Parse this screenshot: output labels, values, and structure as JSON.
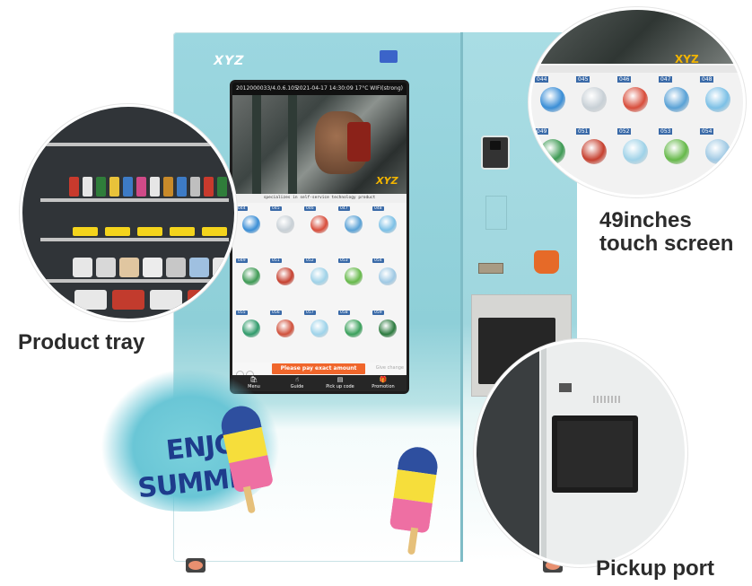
{
  "machine": {
    "brand_logo": "XYZ",
    "screen": {
      "status_left": "2012000033/4.0.6.105",
      "status_right": "2021-04-17 14:30:09  17°C  WIFI(strong)",
      "video_logo": "XYZ",
      "banner_text": "specializes in self-service technology product",
      "products": [
        {
          "slot": "044",
          "color": "#3a8ed6"
        },
        {
          "slot": "045",
          "color": "#c8d0d6"
        },
        {
          "slot": "046",
          "color": "#d84d3b"
        },
        {
          "slot": "047",
          "color": "#5aa2d6"
        },
        {
          "slot": "048",
          "color": "#7cc0e6"
        },
        {
          "slot": "049",
          "color": "#3e9a54"
        },
        {
          "slot": "051",
          "color": "#c6402f"
        },
        {
          "slot": "052",
          "color": "#9fd2e8"
        },
        {
          "slot": "053",
          "color": "#66b94a"
        },
        {
          "slot": "054",
          "color": "#9fc9e4"
        },
        {
          "slot": "055",
          "color": "#2f9a6a"
        },
        {
          "slot": "056",
          "color": "#d0503b"
        },
        {
          "slot": "057",
          "color": "#9ed3ea"
        },
        {
          "slot": "058",
          "color": "#3aa05b"
        },
        {
          "slot": "059",
          "color": "#2c7a3e"
        }
      ],
      "pay_button": "Please pay exact amount",
      "give_change": "Give change",
      "nav": [
        {
          "label": "Menu",
          "icon": "bag-icon"
        },
        {
          "label": "Guide",
          "icon": "hand-icon"
        },
        {
          "label": "Pick up code",
          "icon": "code-icon"
        },
        {
          "label": "Promotion",
          "icon": "gift-icon"
        }
      ]
    },
    "decor": {
      "line1": "ENJOY",
      "line2": "SUMMER"
    }
  },
  "callouts": {
    "tray": "Product tray",
    "screen_line1": "49inches",
    "screen_line2": "touch screen",
    "pickup": "Pickup port"
  },
  "colors": {
    "cabinet": "#9cd7e0",
    "pay_button": "#f0662b",
    "text_navy": "#1e3c8c",
    "popsicle_pink": "#ee6fa3",
    "popsicle_yellow": "#f6de3b"
  }
}
